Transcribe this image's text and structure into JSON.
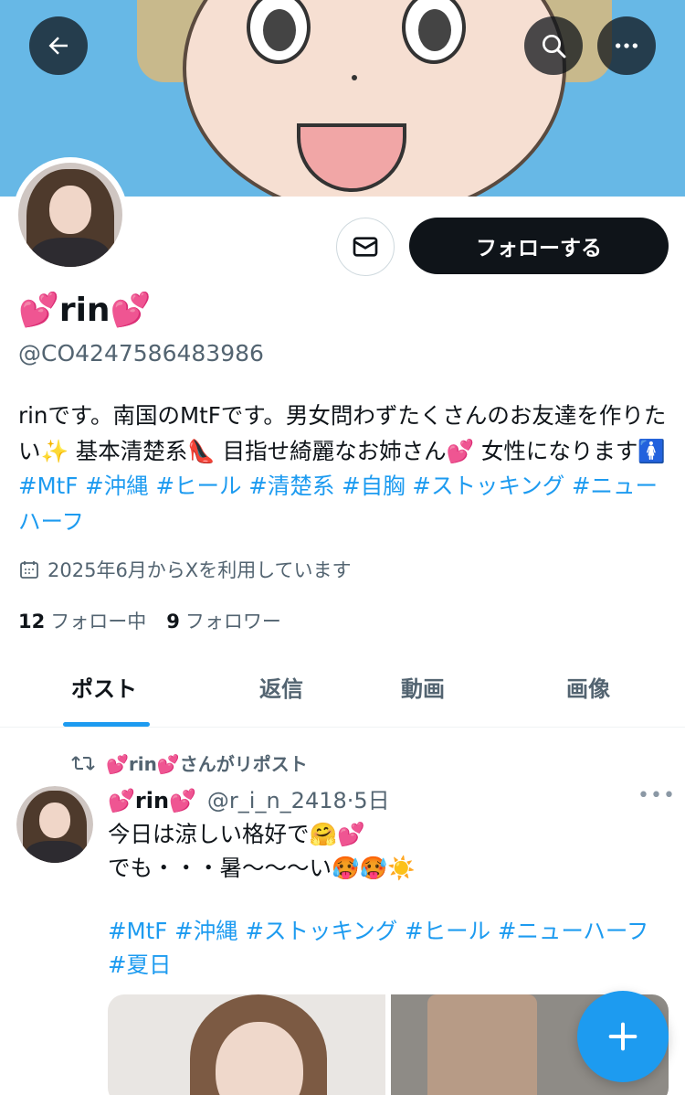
{
  "profile": {
    "name": "💕rin💕",
    "handle": "@CO4247586483986",
    "bio_text": "rinです。南国のMtFです。男女問わずたくさんのお友達を作りたい✨ 基本清楚系👠 目指せ綺麗なお姉さん💕 女性になります🚺 ",
    "bio_tags": "#MtF #沖縄 #ヒール #清楚系 #自胸 #ストッキング #ニューハーフ",
    "joined": "2025年6月からXを利用しています",
    "following_count": "12",
    "following_label": "フォロー中",
    "followers_count": "9",
    "followers_label": "フォロワー"
  },
  "actions": {
    "follow_label": "フォローする"
  },
  "tabs": [
    "ポスト",
    "返信",
    "動画",
    "画像"
  ],
  "post": {
    "repost_label": "💕rin💕さんがリポスト",
    "author_name": "💕rin💕",
    "author_handle": "@r_i_n_2418",
    "time": "5日",
    "text_line1": "今日は涼しい格好で🤗💕",
    "text_line2": "でも・・・暑〜〜〜い🥵🥵☀️",
    "tags": "#MtF #沖縄 #ストッキング #ヒール #ニューハーフ #夏日",
    "more": "•••"
  },
  "colors": {
    "accent": "#1d9bf0",
    "text_primary": "#0f1419",
    "text_secondary": "#536471",
    "follow_button_bg": "#0f1419"
  },
  "icons": {
    "back": "arrow-left-icon",
    "search": "search-icon",
    "more": "more-horizontal-icon",
    "dm": "envelope-icon",
    "calendar": "calendar-icon",
    "repost": "repost-icon",
    "compose": "plus-icon"
  }
}
